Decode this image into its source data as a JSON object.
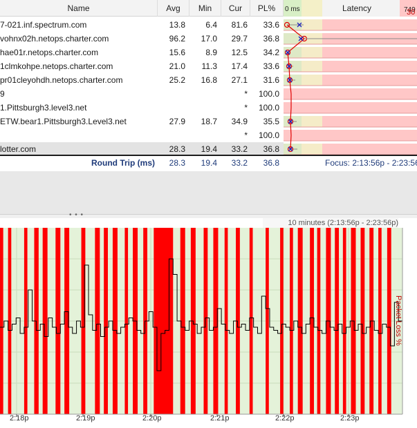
{
  "table": {
    "columns": {
      "name": "Name",
      "avg": "Avg",
      "min": "Min",
      "cur": "Cur",
      "pl": "PL%",
      "zero": "0 ms",
      "latency": "Latency",
      "max": "749"
    },
    "rows": [
      {
        "name": "7-021.inf.spectrum.com",
        "avg": "13.8",
        "min": "6.4",
        "cur": "81.6",
        "pl": "33.6"
      },
      {
        "name": "vohnx02h.netops.charter.com",
        "avg": "96.2",
        "min": "17.0",
        "cur": "29.7",
        "pl": "36.8"
      },
      {
        "name": "hae01r.netops.charter.com",
        "avg": "15.6",
        "min": "8.9",
        "cur": "12.5",
        "pl": "34.2"
      },
      {
        "name": "1clmkohpe.netops.charter.com",
        "avg": "21.0",
        "min": "11.3",
        "cur": "17.4",
        "pl": "33.6"
      },
      {
        "name": "pr01cleyohdh.netops.charter.com",
        "avg": "25.2",
        "min": "16.8",
        "cur": "27.1",
        "pl": "31.6"
      },
      {
        "name": "9",
        "avg": "",
        "min": "",
        "cur": "*",
        "pl": "100.0"
      },
      {
        "name": "1.Pittsburgh3.level3.net",
        "avg": "",
        "min": "",
        "cur": "*",
        "pl": "100.0"
      },
      {
        "name": "ETW.bear1.Pittsburgh3.Level3.net",
        "avg": "27.9",
        "min": "18.7",
        "cur": "34.9",
        "pl": "35.5"
      },
      {
        "name": "",
        "avg": "",
        "min": "",
        "cur": "*",
        "pl": "100.0"
      },
      {
        "name": "lotter.com",
        "avg": "28.3",
        "min": "19.4",
        "cur": "33.2",
        "pl": "36.8"
      }
    ],
    "summary": {
      "label": "Round Trip (ms)",
      "avg": "28.3",
      "min": "19.4",
      "cur": "33.2",
      "pl": "36.8",
      "focus": "Focus: 2:13:56p - 2:23:56"
    }
  },
  "chart": {
    "range_label": "10 minutes (2:13:56p - 2:23:56p)",
    "y_max": "30",
    "y_title": "Packet Loss %",
    "x_ticks": [
      "2:18p",
      "2:19p",
      "2:20p",
      "2:21p",
      "2:22p",
      "2:23p"
    ]
  },
  "colors": {
    "loss": "#ff0000",
    "good": "#e4f2d9",
    "row_loss": "#ffc7c7",
    "line": "#000000",
    "accent": "#1f3b7a"
  },
  "splitter": {
    "grip": "• • •"
  },
  "chart_data": {
    "type": "line",
    "x_range": [
      "2:13:56p",
      "2:23:56p"
    ],
    "ylabel": "Packet Loss %",
    "y_max": 30,
    "x_ticks": [
      "2:18p",
      "2:19p",
      "2:20p",
      "2:21p",
      "2:22p",
      "2:23p"
    ],
    "loss_intervals": [
      [
        0.0,
        0.008
      ],
      [
        0.02,
        0.028
      ],
      [
        0.06,
        0.068
      ],
      [
        0.085,
        0.096
      ],
      [
        0.106,
        0.118
      ],
      [
        0.138,
        0.15
      ],
      [
        0.16,
        0.172
      ],
      [
        0.202,
        0.212
      ],
      [
        0.236,
        0.248
      ],
      [
        0.258,
        0.268
      ],
      [
        0.28,
        0.292
      ],
      [
        0.31,
        0.318
      ],
      [
        0.33,
        0.342
      ],
      [
        0.356,
        0.366
      ],
      [
        0.382,
        0.43
      ],
      [
        0.448,
        0.46
      ],
      [
        0.474,
        0.486
      ],
      [
        0.506,
        0.516
      ],
      [
        0.53,
        0.542
      ],
      [
        0.558,
        0.566
      ],
      [
        0.586,
        0.596
      ],
      [
        0.62,
        0.628
      ],
      [
        0.66,
        0.668
      ],
      [
        0.696,
        0.704
      ],
      [
        0.72,
        0.728
      ],
      [
        0.74,
        0.752
      ],
      [
        0.77,
        0.78
      ],
      [
        0.788,
        0.796
      ],
      [
        0.81,
        0.822
      ],
      [
        0.832,
        0.842
      ],
      [
        0.852,
        0.86
      ],
      [
        0.872,
        0.884
      ],
      [
        0.896,
        0.906
      ],
      [
        0.918,
        0.928
      ],
      [
        0.94,
        0.948
      ],
      [
        0.962,
        0.972
      ]
    ],
    "latency_series": [
      [
        0.0,
        28
      ],
      [
        0.01,
        30
      ],
      [
        0.02,
        27
      ],
      [
        0.03,
        29
      ],
      [
        0.04,
        31
      ],
      [
        0.05,
        26
      ],
      [
        0.06,
        28
      ],
      [
        0.07,
        40
      ],
      [
        0.08,
        30
      ],
      [
        0.09,
        27
      ],
      [
        0.1,
        29
      ],
      [
        0.11,
        25
      ],
      [
        0.12,
        31
      ],
      [
        0.13,
        28
      ],
      [
        0.14,
        26
      ],
      [
        0.15,
        29
      ],
      [
        0.16,
        33
      ],
      [
        0.17,
        28
      ],
      [
        0.18,
        26
      ],
      [
        0.19,
        30
      ],
      [
        0.2,
        28
      ],
      [
        0.21,
        48
      ],
      [
        0.22,
        32
      ],
      [
        0.23,
        27
      ],
      [
        0.24,
        29
      ],
      [
        0.25,
        25
      ],
      [
        0.26,
        28
      ],
      [
        0.27,
        30
      ],
      [
        0.28,
        27
      ],
      [
        0.29,
        26
      ],
      [
        0.3,
        28
      ],
      [
        0.31,
        29
      ],
      [
        0.32,
        31
      ],
      [
        0.33,
        30
      ],
      [
        0.34,
        27
      ],
      [
        0.35,
        26
      ],
      [
        0.36,
        30
      ],
      [
        0.37,
        33
      ],
      [
        0.38,
        28
      ],
      [
        0.39,
        14
      ],
      [
        0.4,
        26
      ],
      [
        0.41,
        27
      ],
      [
        0.42,
        50
      ],
      [
        0.43,
        45
      ],
      [
        0.44,
        30
      ],
      [
        0.45,
        28
      ],
      [
        0.46,
        27
      ],
      [
        0.47,
        30
      ],
      [
        0.48,
        29
      ],
      [
        0.49,
        26
      ],
      [
        0.5,
        28
      ],
      [
        0.51,
        31
      ],
      [
        0.52,
        27
      ],
      [
        0.53,
        28
      ],
      [
        0.54,
        34
      ],
      [
        0.55,
        29
      ],
      [
        0.56,
        27
      ],
      [
        0.57,
        26
      ],
      [
        0.58,
        30
      ],
      [
        0.59,
        28
      ],
      [
        0.6,
        29
      ],
      [
        0.61,
        27
      ],
      [
        0.62,
        31
      ],
      [
        0.63,
        28
      ],
      [
        0.64,
        26
      ],
      [
        0.65,
        38
      ],
      [
        0.66,
        34
      ],
      [
        0.67,
        28
      ],
      [
        0.68,
        27
      ],
      [
        0.69,
        26
      ],
      [
        0.7,
        29
      ],
      [
        0.71,
        28
      ],
      [
        0.72,
        27
      ],
      [
        0.73,
        30
      ],
      [
        0.74,
        28
      ],
      [
        0.75,
        26
      ],
      [
        0.76,
        29
      ],
      [
        0.77,
        31
      ],
      [
        0.78,
        28
      ],
      [
        0.79,
        27
      ],
      [
        0.8,
        26
      ],
      [
        0.81,
        30
      ],
      [
        0.82,
        28
      ],
      [
        0.83,
        27
      ],
      [
        0.84,
        29
      ],
      [
        0.85,
        26
      ],
      [
        0.86,
        28
      ],
      [
        0.87,
        30
      ],
      [
        0.88,
        27
      ],
      [
        0.89,
        29
      ],
      [
        0.9,
        26
      ],
      [
        0.91,
        28
      ],
      [
        0.92,
        30
      ],
      [
        0.93,
        27
      ],
      [
        0.94,
        26
      ],
      [
        0.95,
        29
      ],
      [
        0.96,
        28
      ],
      [
        0.97,
        22
      ],
      [
        0.98,
        36
      ],
      [
        0.99,
        30
      ],
      [
        1.0,
        28
      ]
    ],
    "latency_axis_max": 60
  }
}
